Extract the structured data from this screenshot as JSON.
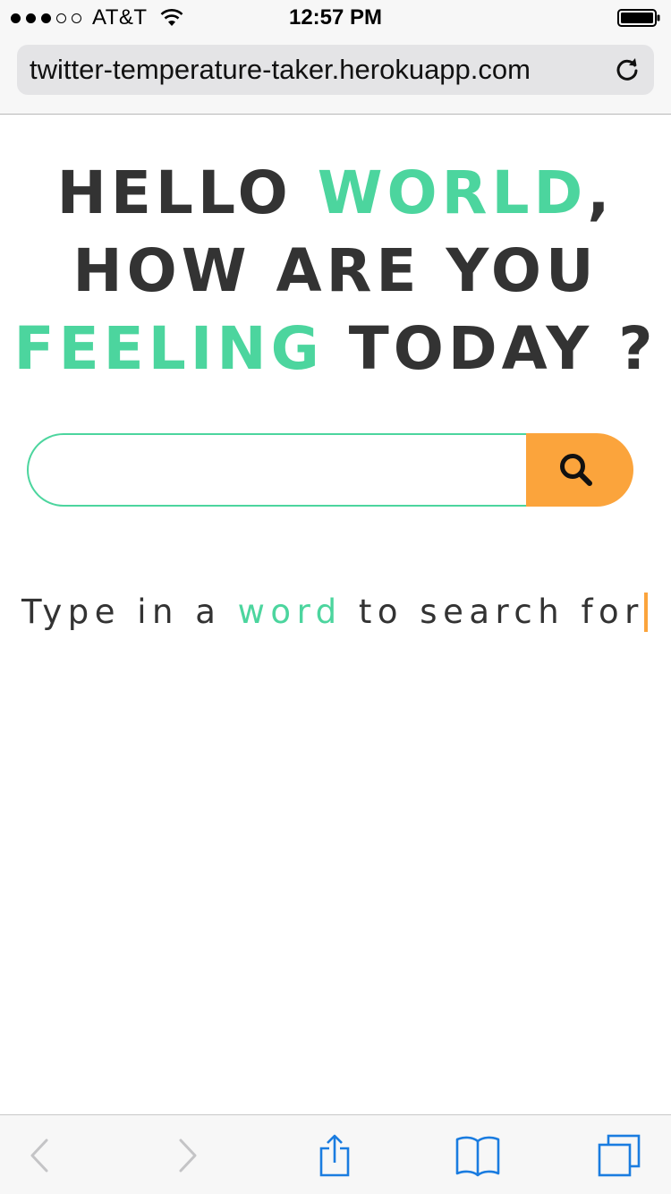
{
  "status_bar": {
    "carrier": "AT&T",
    "time": "12:57 PM",
    "signal_bars_filled": 3,
    "signal_bars_total": 5
  },
  "browser": {
    "url": "twitter-temperature-taker.herokuapp.com"
  },
  "headline": {
    "part1": "HELLO ",
    "part1_accent": "WORLD",
    "part2": ",",
    "line2": "HOW ARE YOU",
    "line3_accent": "FEELING",
    "line3": " TODAY ?"
  },
  "search": {
    "value": "",
    "placeholder": "",
    "button_icon": "search-icon"
  },
  "prompt": {
    "before": "Type in a ",
    "accent": "word",
    "after": " to search for"
  },
  "toolbar": {
    "back_icon": "chevron-left-icon",
    "forward_icon": "chevron-right-icon",
    "share_icon": "share-icon",
    "bookmarks_icon": "book-icon",
    "tabs_icon": "tabs-icon"
  },
  "colors": {
    "accent_green": "#4cd59e",
    "accent_orange": "#fba43c",
    "text_dark": "#333333",
    "ios_blue": "#1a7ce0"
  }
}
